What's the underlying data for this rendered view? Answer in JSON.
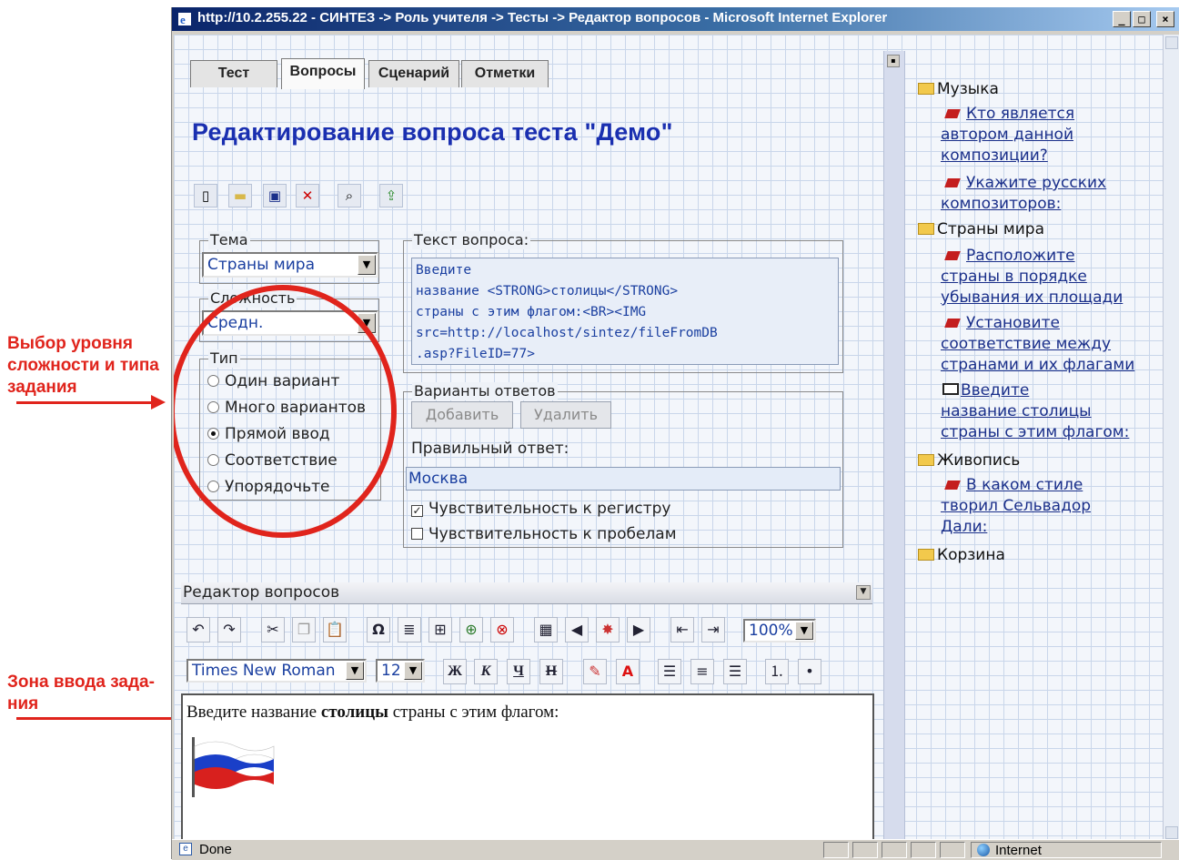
{
  "annotations": {
    "level_label": [
      "Выбор уровня",
      "сложности и типа",
      "задания"
    ],
    "zone_label": [
      "Зона ввода зада-",
      "ния"
    ],
    "color": "#e0241c"
  },
  "window": {
    "title": "http://10.2.255.22 - СИНТЕЗ -> Роль учителя -> Тесты -> Редактор вопросов - Microsoft Internet Explorer",
    "min": "_",
    "max": "□",
    "close": "×"
  },
  "tabs": [
    "Тест",
    "Вопросы",
    "Сценарий",
    "Отметки"
  ],
  "heading": "Редактирование вопроса теста \"Демо\"",
  "topic": {
    "legend": "Тема",
    "value": "Страны мира"
  },
  "difficulty": {
    "legend": "Сложность",
    "value": "Средн."
  },
  "type": {
    "legend": "Тип",
    "options": [
      "Один вариант",
      "Много вариантов",
      "Прямой ввод",
      "Соответствие",
      "Упорядочьте"
    ],
    "selected": 2
  },
  "question_text": {
    "legend": "Текст вопроса:",
    "lines": [
      "Введите",
      "название <STRONG>столицы</STRONG>",
      "страны с этим флагом:<BR><IMG",
      "src=http://localhost/sintez/fileFromDB",
      ".asp?FileID=77>"
    ]
  },
  "answers": {
    "legend": "Варианты ответов",
    "add": "Добавить",
    "delete": "Удалить",
    "correct_label": "Правильный ответ:",
    "correct_value": "Москва",
    "case_label": "Чувствительность к регистру",
    "case_checked": true,
    "space_label": "Чувствительность к пробелам",
    "space_checked": false
  },
  "editor": {
    "panel_title": "Редактор вопросов",
    "zoom": "100%",
    "font": "Times New Roman",
    "size": "12",
    "bold": "Ж",
    "italic": "К",
    "underline": "Ч",
    "strike": "Н",
    "content_before": "Введите название ",
    "content_bold": "столицы",
    "content_after": " страны с этим флагом:"
  },
  "tree": [
    {
      "folder": "Музыка",
      "items": [
        {
          "icon": "question-icon",
          "lines": [
            "Кто является",
            "автором данной",
            "композиции?"
          ]
        },
        {
          "icon": "question-icon",
          "lines": [
            "Укажите русских",
            "композиторов:"
          ]
        }
      ]
    },
    {
      "folder": "Страны мира",
      "items": [
        {
          "icon": "question-icon",
          "lines": [
            "Расположите",
            "страны в порядке",
            "убывания их площади"
          ]
        },
        {
          "icon": "question-icon",
          "lines": [
            "Установите",
            "соответствие между",
            "странами и их флагами"
          ]
        },
        {
          "icon": "book-icon",
          "lines": [
            "Введите",
            "название столицы",
            "страны с этим флагом:"
          ]
        }
      ]
    },
    {
      "folder": "Живопись",
      "items": [
        {
          "icon": "question-icon",
          "lines": [
            "В каком стиле",
            "творил Сельвадор",
            "Дали:"
          ]
        }
      ]
    },
    {
      "folder": "Корзина",
      "items": []
    }
  ],
  "status": {
    "left": "Done",
    "zone": "Internet"
  }
}
